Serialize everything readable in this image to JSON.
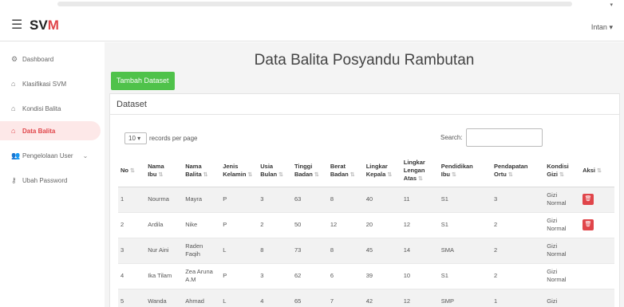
{
  "navbar": {
    "brand_sv": "SV",
    "brand_m": "M",
    "user": "Intan"
  },
  "sidebar": {
    "items": [
      {
        "label": "Dashboard",
        "icon": "dashboard-icon"
      },
      {
        "label": "Klasifikasi SVM",
        "icon": "home-icon"
      },
      {
        "label": "Kondisi Balita",
        "icon": "home-icon"
      },
      {
        "label": "Data Balita",
        "icon": "home-icon",
        "active": true
      },
      {
        "label": "Pengelolaan User",
        "icon": "users-icon"
      },
      {
        "label": "Ubah Password",
        "icon": "key-icon"
      }
    ]
  },
  "main": {
    "title": "Data Balita Posyandu Rambutan",
    "add_button": "Tambah Dataset",
    "card_title": "Dataset",
    "length_value": "10",
    "length_suffix": "records per page",
    "search_label": "Search:"
  },
  "table": {
    "headers": [
      "No",
      "Nama Ibu",
      "Nama Balita",
      "Jenis Kelamin",
      "Usia Bulan",
      "Tinggi Badan",
      "Berat Badan",
      "Lingkar Kepala",
      "Lingkar Lengan Atas",
      "Pendidikan Ibu",
      "Pendapatan Ortu",
      "Kondisi Gizi",
      "Aksi"
    ],
    "rows": [
      [
        "1",
        "Nourma",
        "Mayra",
        "P",
        "3",
        "63",
        "8",
        "40",
        "11",
        "S1",
        "3",
        "Gizi Normal"
      ],
      [
        "2",
        "Ardila",
        "Nike",
        "P",
        "2",
        "50",
        "12",
        "20",
        "12",
        "S1",
        "2",
        "Gizi Normal"
      ],
      [
        "3",
        "Nur Aini",
        "Raden Faqih",
        "L",
        "8",
        "73",
        "8",
        "45",
        "14",
        "SMA",
        "2",
        "Gizi Normal"
      ],
      [
        "4",
        "Ika Tilam",
        "Zea Aruna A.M",
        "P",
        "3",
        "62",
        "6",
        "39",
        "10",
        "S1",
        "2",
        "Gizi Normal"
      ],
      [
        "5",
        "Wanda",
        "Ahmad",
        "L",
        "4",
        "65",
        "7",
        "42",
        "12",
        "SMP",
        "1",
        "Gizi"
      ]
    ]
  }
}
